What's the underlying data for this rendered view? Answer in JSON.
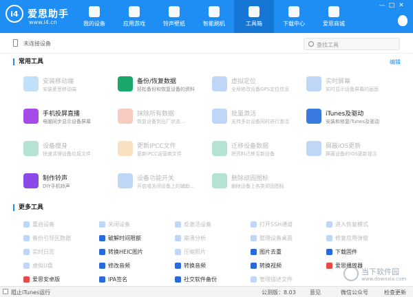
{
  "app": {
    "logo": "i4",
    "brand": "爱思助手",
    "url": "www.i4.cn"
  },
  "window": {
    "min": "—",
    "max": "□",
    "close": "✕"
  },
  "nav": [
    {
      "label": "我的设备",
      "icon": "phone-icon"
    },
    {
      "label": "应用游戏",
      "icon": "apps-icon"
    },
    {
      "label": "铃声壁纸",
      "icon": "music-icon"
    },
    {
      "label": "智能刷机",
      "icon": "gear-icon"
    },
    {
      "label": "工具箱",
      "icon": "toolbox-icon"
    },
    {
      "label": "下载中心",
      "icon": "download-icon"
    },
    {
      "label": "爱思商城",
      "icon": "shop-icon"
    }
  ],
  "device": {
    "status": "未连接设备"
  },
  "search": {
    "placeholder": "查找工具"
  },
  "common": {
    "title": "常用工具",
    "edit": "编辑",
    "tools": [
      {
        "name": "安装移动端",
        "desc": "安装爱思移动端",
        "color": "#4aa8e8",
        "dim": true
      },
      {
        "name": "备份/恢复数据",
        "desc": "轻松备份和恢复设备的资料",
        "color": "#1aa86a",
        "dim": false
      },
      {
        "name": "虚拟定位",
        "desc": "全局修改设备GPS定位信息",
        "color": "#4a8ae8",
        "dim": true
      },
      {
        "name": "实时屏幕",
        "desc": "实时显示设备屏幕的画面",
        "color": "#4a8ae8",
        "dim": true
      },
      {
        "name": "手机投屏直播",
        "desc": "电脑同步显示设备屏幕",
        "color": "#a64ae8",
        "dim": false
      },
      {
        "name": "抹除所有数据",
        "desc": "恢复设备到出厂状态...",
        "color": "#e86a4a",
        "dim": true
      },
      {
        "name": "批量激活",
        "desc": "支持多台设备同时进行激活",
        "color": "#4a8ae8",
        "dim": true
      },
      {
        "name": "iTunes及驱动",
        "desc": "安装和修复iTunes及驱动",
        "color": "#3a7be0",
        "dim": false
      },
      {
        "name": "设备瘦身",
        "desc": "快速清理设备垃圾文件",
        "color": "#2ab07a",
        "dim": true
      },
      {
        "name": "更新IPCC文件",
        "desc": "更新IPCC运营商文件",
        "color": "#e8a84a",
        "dim": true
      },
      {
        "name": "迁移设备数据",
        "desc": "把资料迁移至新设备",
        "color": "#2ab07a",
        "dim": true
      },
      {
        "name": "屏蔽iOS更新",
        "desc": "屏蔽设备的iOS更新提示",
        "color": "#4a8ae8",
        "dim": true
      },
      {
        "name": "制作铃声",
        "desc": "DIY手机铃声",
        "color": "#8a4ae8",
        "dim": false
      },
      {
        "name": "设备功能开关",
        "desc": "开启或关闭设备上的辅助...",
        "color": "#4a8ae8",
        "dim": true
      },
      {
        "name": "删除顽固图标",
        "desc": "删除设备上各类顽固图标",
        "color": "#2ab07a",
        "dim": true
      }
    ]
  },
  "more": {
    "title": "更多工具",
    "items": [
      {
        "label": "重启设备",
        "color": "#4a8ae8",
        "dim": true
      },
      {
        "label": "关闭设备",
        "color": "#4a8ae8",
        "dim": true
      },
      {
        "label": "反激活设备",
        "color": "#4a8ae8",
        "dim": true
      },
      {
        "label": "打开SSH通道",
        "color": "#4a8ae8",
        "dim": true
      },
      {
        "label": "进入恢复模式",
        "color": "#4a8ae8",
        "dim": true
      },
      {
        "label": "备份引导区数据",
        "color": "#4a8ae8",
        "dim": true
      },
      {
        "label": "破解时间限额",
        "color": "#2a6ad8",
        "dim": false
      },
      {
        "label": "崩溃分析",
        "color": "#4a8ae8",
        "dim": true
      },
      {
        "label": "整理设备桌面",
        "color": "#4a8ae8",
        "dim": true
      },
      {
        "label": "修复应用弹窗",
        "color": "#4a8ae8",
        "dim": true
      },
      {
        "label": "实时日志",
        "color": "#4a8ae8",
        "dim": true
      },
      {
        "label": "转换HEIC图片",
        "color": "#2a6ad8",
        "dim": false
      },
      {
        "label": "压缩照片",
        "color": "#4a8ae8",
        "dim": true
      },
      {
        "label": "图片去重",
        "color": "#2a6ad8",
        "dim": false
      },
      {
        "label": "下载固件",
        "color": "#2a6ad8",
        "dim": false
      },
      {
        "label": "虚拟U盘",
        "color": "#4a8ae8",
        "dim": true
      },
      {
        "label": "修改音频",
        "color": "#2a6ad8",
        "dim": false
      },
      {
        "label": "转换音频",
        "color": "#2a6ad8",
        "dim": false
      },
      {
        "label": "转换视频",
        "color": "#2a6ad8",
        "dim": false
      },
      {
        "label": "爱思播放器",
        "color": "#e84a4a",
        "dim": false
      },
      {
        "label": "爱思安卓版",
        "color": "#e84a4a",
        "dim": false
      },
      {
        "label": "IPA签名",
        "color": "#2a6ad8",
        "dim": false
      },
      {
        "label": "社交软件备份",
        "color": "#2a6ad8",
        "dim": false
      },
      {
        "label": "管理描述文件",
        "color": "#4a8ae8",
        "dim": true
      }
    ]
  },
  "statusbar": {
    "itunes": "阻止iTunes运行",
    "version": "公测版：8.03",
    "feedback": "意见",
    "wechat": "微信公众号",
    "update": "检查更新"
  },
  "watermark": {
    "title": "当下软件园",
    "url": "www.downxia.com"
  }
}
